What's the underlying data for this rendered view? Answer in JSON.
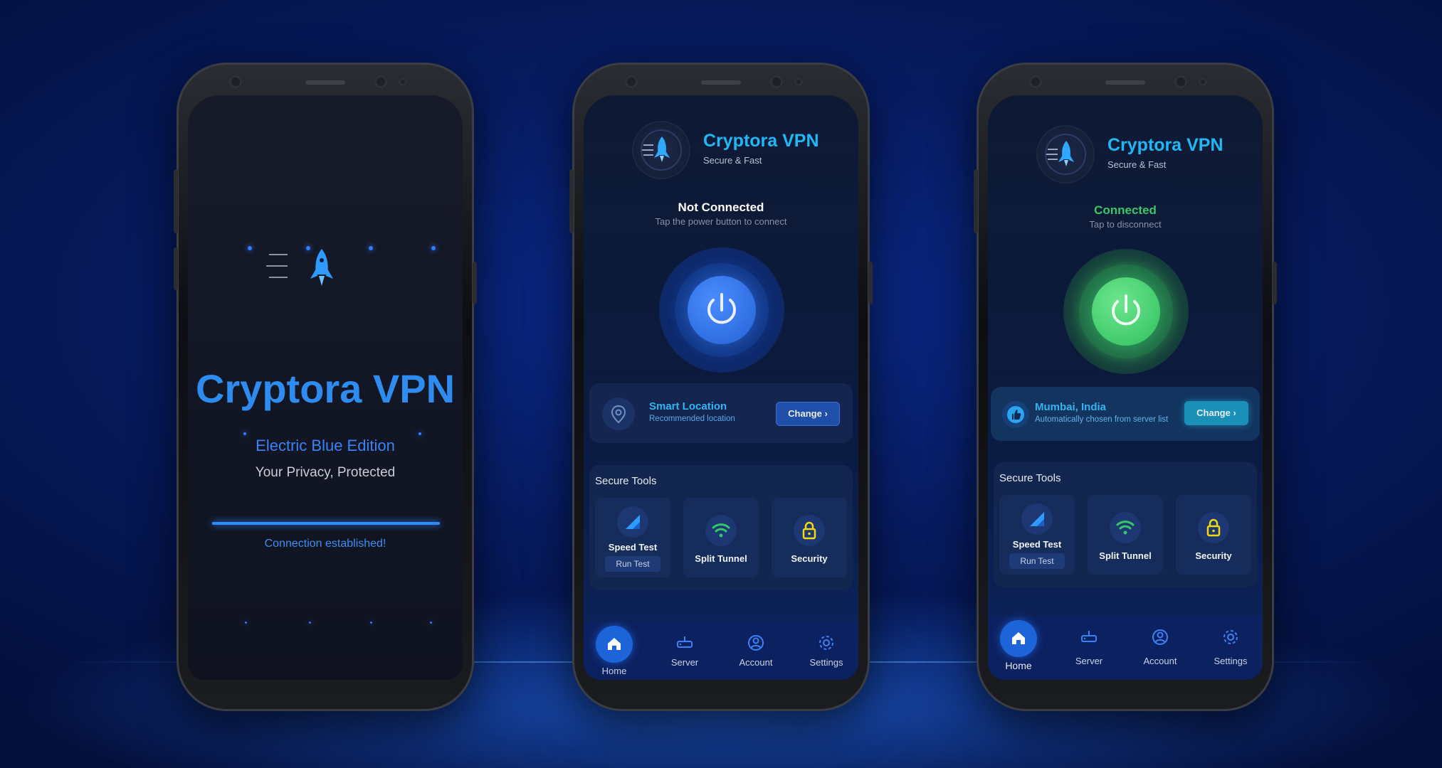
{
  "splash": {
    "title": "Cryptora VPN",
    "edition": "Electric Blue Edition",
    "tagline": "Your Privacy, Protected",
    "status": "Connection established!",
    "progress_percent": 100,
    "logo_icon": "rocket-icon"
  },
  "app": {
    "title": "Cryptora VPN",
    "subtitle": "Secure & Fast",
    "logo_icon": "rocket-icon"
  },
  "screen_disconnected": {
    "status_title": "Not Connected",
    "status_sub": "Tap the power button to connect",
    "status_color": "#ffffff",
    "power_color": "#2f6fe6",
    "location": {
      "name": "Smart Location",
      "desc": "Recommended location",
      "icon": "location-pin-icon",
      "change_label": "Change"
    }
  },
  "screen_connected": {
    "status_title": "Connected",
    "status_sub": "Tap to disconnect",
    "status_color": "#38c86a",
    "power_color": "#3fd172",
    "location": {
      "name": "Mumbai, India",
      "desc": "Automatically chosen from server list",
      "icon": "thumbs-up-icon",
      "change_label": "Change"
    }
  },
  "tools": {
    "title": "Secure Tools",
    "items": [
      {
        "label": "Speed Test",
        "icon": "signal-icon",
        "action": "Run Test"
      },
      {
        "label": "Split Tunnel",
        "icon": "wifi-icon"
      },
      {
        "label": "Security",
        "icon": "lock-icon"
      }
    ]
  },
  "nav": {
    "items": [
      {
        "label": "Home",
        "icon": "home-icon"
      },
      {
        "label": "Server",
        "icon": "server-icon"
      },
      {
        "label": "Account",
        "icon": "account-icon"
      },
      {
        "label": "Settings",
        "icon": "gear-icon"
      }
    ]
  },
  "colors": {
    "accent": "#1fb8f5",
    "brand_blue": "#2e8cf0",
    "connected_green": "#3fd172",
    "background": "#061a5e"
  }
}
